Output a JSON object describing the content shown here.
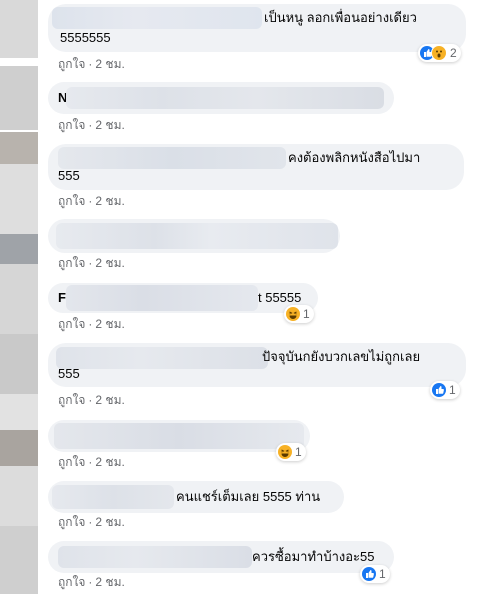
{
  "comments": [
    {
      "line1": "เป็นหนู ลอกเพื่อนอย่างเดียว",
      "line2": "5555555",
      "like": "ถูกใจ",
      "time": "2 ชม.",
      "reaction_count": "2"
    },
    {
      "line1": "N",
      "like": "ถูกใจ",
      "time": "2 ชม."
    },
    {
      "line1": "คงต้องพลิกหนังสือไปมา",
      "line2": "555",
      "like": "ถูกใจ",
      "time": "2 ชม."
    },
    {
      "line1": "",
      "like": "ถูกใจ",
      "time": "2 ชม."
    },
    {
      "line1_lead": "F",
      "line1": "t 55555",
      "like": "ถูกใจ",
      "time": "2 ชม.",
      "reaction_count": "1"
    },
    {
      "line1": "ปัจจุบันกยังบวกเลขไม่ถูกเลย",
      "line2": "555",
      "like": "ถูกใจ",
      "time": "2 ชม.",
      "reaction_count": "1"
    },
    {
      "line1": "",
      "like": "ถูกใจ",
      "time": "2 ชม.",
      "reaction_count": "1"
    },
    {
      "line1": "คนแชร์เต็มเลย 5555 ท่าน",
      "like": "ถูกใจ",
      "time": "2 ชม."
    },
    {
      "line1": "ควรซื้อมาทำบ้างอะ55",
      "like": "ถูกใจ",
      "time": "2 ชม.",
      "reaction_count": "1"
    }
  ],
  "separator": "·",
  "icons": {
    "like": "like-icon",
    "haha": "haha-icon",
    "wow": "wow-icon"
  },
  "colors": {
    "bubble": "#f0f2f5",
    "meta": "#65676b",
    "like_blue": "#1877f2",
    "emoji_yellow": "#f7b125"
  }
}
